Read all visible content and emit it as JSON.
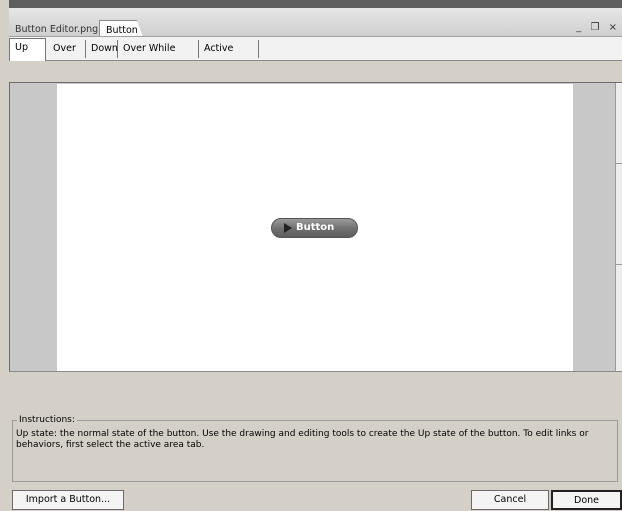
{
  "document_tabs": [
    {
      "label": "Button Editor.png",
      "active": false
    },
    {
      "label": "Button",
      "active": true
    }
  ],
  "window_controls": {
    "minimize": "_",
    "restore": "❐",
    "close": "×"
  },
  "state_tabs": [
    {
      "label": "Up",
      "selected": true
    },
    {
      "label": "Over",
      "selected": false
    },
    {
      "label": "Down",
      "selected": false
    },
    {
      "label": "Over While Down",
      "selected": false
    },
    {
      "label": "Active Area",
      "selected": false
    }
  ],
  "preview_button": {
    "label": "Button",
    "icon": "play-arrow-icon"
  },
  "instructions": {
    "title": "Instructions:",
    "text": "Up state: the normal state of the button. Use the drawing and editing tools to create the Up state of the button. To edit links or behaviors, first select the active area tab."
  },
  "footer": {
    "import_label": "Import a Button...",
    "cancel_label": "Cancel",
    "done_label": "Done"
  }
}
